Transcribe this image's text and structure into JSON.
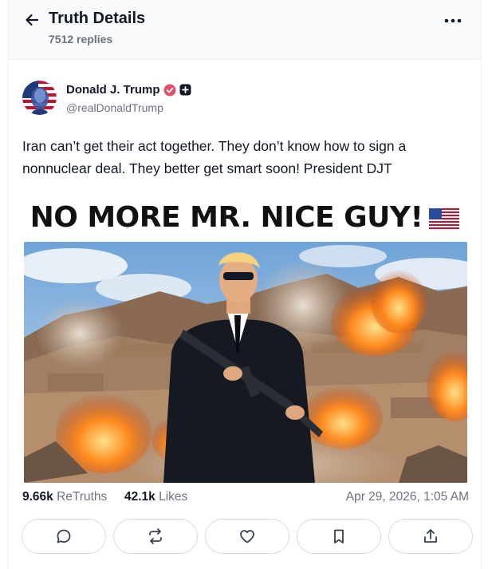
{
  "header": {
    "title": "Truth Details",
    "reply_count": "7512 replies"
  },
  "post": {
    "author_name": "Donald J. Trump",
    "author_handle": "@realDonaldTrump",
    "text": "Iran can’t get their act together. They don’t know how to sign a nonnuclear deal. They better get smart soon! President DJT",
    "media_caption": "NO MORE MR. NICE GUY!",
    "stats": {
      "retruths_count": "9.66k",
      "retruths_label": "ReTruths",
      "likes_count": "42.1k",
      "likes_label": "Likes",
      "date": "Apr 29, 2026, 1:05 AM"
    }
  },
  "actions": [
    "reply-icon",
    "retruth-icon",
    "like-icon",
    "bookmark-icon",
    "share-icon"
  ],
  "colors": {
    "verified": "#e0526c",
    "muted_text": "#6b7280",
    "header_bg": "#f9fafb",
    "border": "#d7dbe0"
  }
}
